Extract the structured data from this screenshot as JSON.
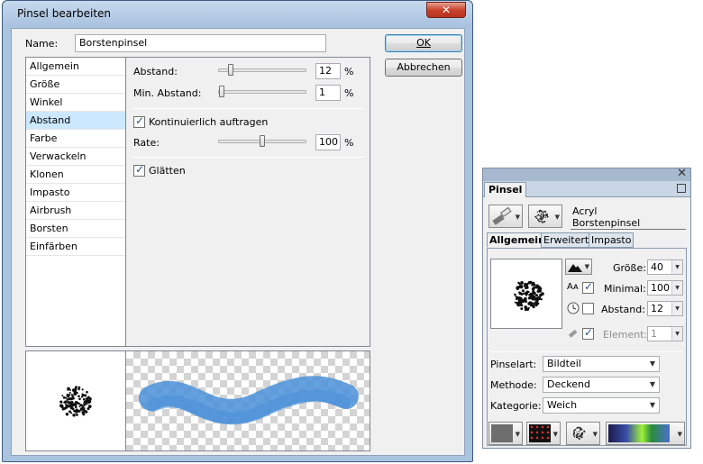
{
  "dialog": {
    "title": "Pinsel bearbeiten",
    "close_glyph": "✕",
    "name_label": "Name:",
    "name_value": "Borstenpinsel",
    "ok_label": "OK",
    "cancel_label": "Abbrechen",
    "categories": [
      "Allgemein",
      "Größe",
      "Winkel",
      "Abstand",
      "Farbe",
      "Verwackeln",
      "Klonen",
      "Impasto",
      "Airbrush",
      "Borsten",
      "Einfärben"
    ],
    "selected_category": "Abstand",
    "abstand_label": "Abstand:",
    "abstand_value": "12",
    "abstand_unit": "%",
    "abstand_fraction": 0.12,
    "min_abstand_label": "Min. Abstand:",
    "min_abstand_value": "1",
    "min_abstand_unit": "%",
    "min_abstand_fraction": 0.01,
    "continuous_label": "Kontinuierlich auftragen",
    "continuous_checked": true,
    "rate_label": "Rate:",
    "rate_value": "100",
    "rate_unit": "%",
    "rate_fraction": 0.5,
    "smooth_label": "Glätten",
    "smooth_checked": true,
    "stroke_color": "#4a90d9"
  },
  "palette": {
    "tab_label": "Pinsel",
    "close_glyph": "✕",
    "category_name": "Acryl",
    "brush_name": "Borstenpinsel",
    "tabs": [
      "Allgemein",
      "Erweitert",
      "Impasto"
    ],
    "active_tab": "Allgemein",
    "size_label": "Größe:",
    "size_value": "40",
    "minimal_label": "Minimal:",
    "minimal_value": "100",
    "spacing_label": "Abstand:",
    "spacing_value": "12",
    "element_label": "Element:",
    "element_value": "1",
    "pinselart_label": "Pinselart:",
    "pinselart_value": "Bildteil",
    "methode_label": "Methode:",
    "methode_value": "Deckend",
    "kategorie_label": "Kategorie:",
    "kategorie_value": "Weich",
    "icons": [
      "brush-icon",
      "dabs-icon",
      "mountain-icon",
      "pressure-icon",
      "clock-icon",
      "airbrush-icon"
    ]
  }
}
